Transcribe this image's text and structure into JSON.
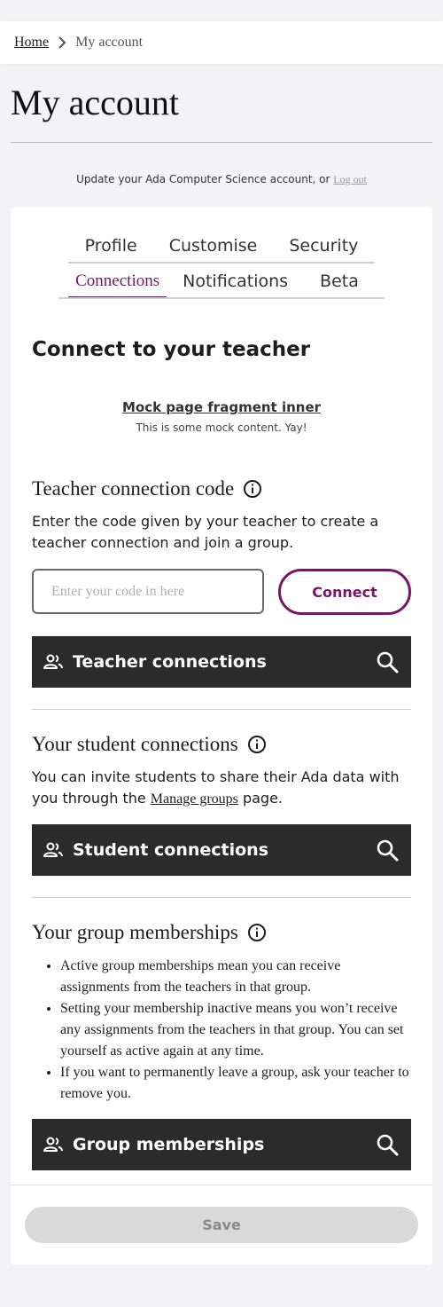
{
  "breadcrumb": {
    "home": "Home",
    "current": "My account"
  },
  "page": {
    "title": "My account"
  },
  "account_note": {
    "text": "Update your Ada Computer Science account, or ",
    "logout": "Log out"
  },
  "tabs": {
    "row1": [
      {
        "label": "Profile"
      },
      {
        "label": "Customise"
      },
      {
        "label": "Security"
      }
    ],
    "row2": [
      {
        "label": "Connections",
        "active": true
      },
      {
        "label": "Notifications"
      },
      {
        "label": "Beta"
      }
    ]
  },
  "connect": {
    "heading": "Connect to your teacher",
    "mock_title": "Mock page fragment inner",
    "mock_body": "This is some mock content. Yay!"
  },
  "teacher_code": {
    "heading": "Teacher connection code",
    "description": "Enter the code given by your teacher to create a teacher connection and join a group.",
    "placeholder": "Enter your code in here",
    "connect_label": "Connect",
    "bar_label": "Teacher connections"
  },
  "student": {
    "heading": "Your student connections",
    "desc_before": "You can invite students to share their Ada data with you through the ",
    "desc_link": "Manage groups",
    "desc_after": " page.",
    "bar_label": "Student connections"
  },
  "groups": {
    "heading": "Your group memberships",
    "bullets": [
      "Active group memberships mean you can receive assignments from the teachers in that group.",
      "Setting your membership inactive means you won’t receive any assignments from the teachers in that group. You can set yourself as active again at any time.",
      "If you want to permanently leave a group, ask your teacher to remove you."
    ],
    "bar_label": "Group memberships"
  },
  "save_label": "Save",
  "colors": {
    "accent": "#7a1467",
    "dark_bar": "#2b2b2b",
    "page_bg": "#f3f3f6"
  },
  "icons": [
    "chevron-right-icon",
    "info-icon",
    "people-icon",
    "search-icon"
  ]
}
